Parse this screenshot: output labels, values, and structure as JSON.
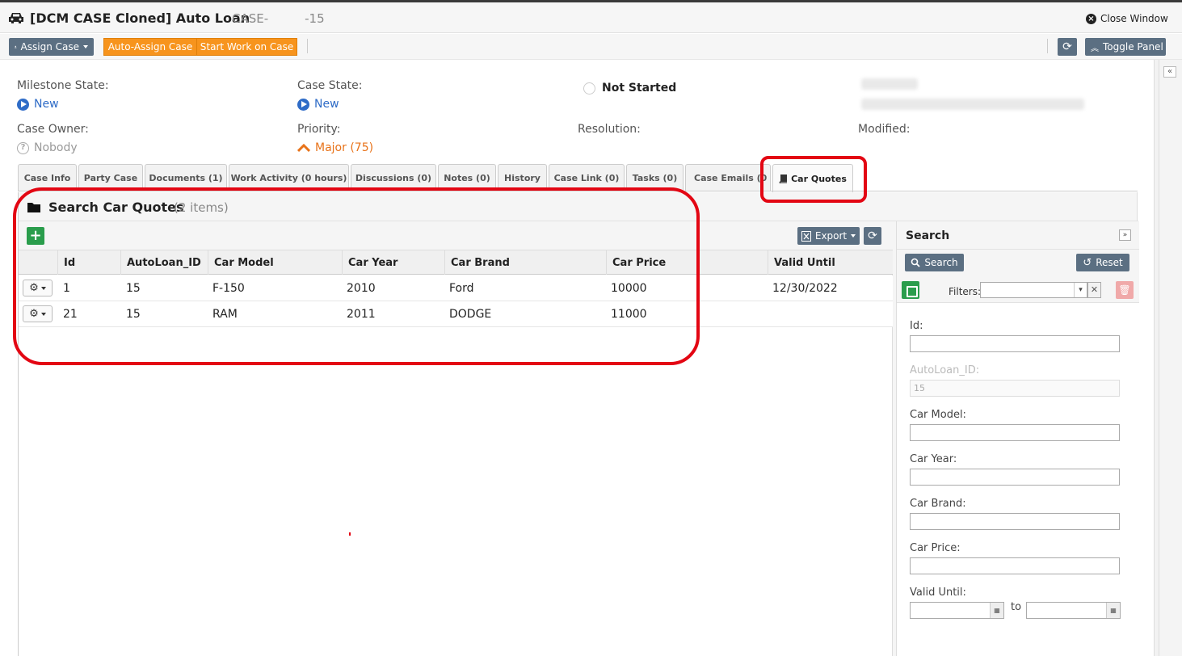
{
  "window": {
    "title": "[DCM CASE Cloned] Auto Loan",
    "case_number": "CASE-   -15",
    "close_label": "Close Window"
  },
  "toolbar": {
    "assign_case": "Assign Case",
    "auto_assign": "Auto-Assign Case",
    "start_work": "Start Work on Case",
    "toggle_panel": "Toggle Panel"
  },
  "summary": {
    "milestone_label": "Milestone State:",
    "milestone_value": "New",
    "case_state_label": "Case State:",
    "case_state_value": "New",
    "status": "Not Started",
    "owner_label": "Case Owner:",
    "owner_value": "Nobody",
    "priority_label": "Priority:",
    "priority_value": "Major (75)",
    "resolution_label": "Resolution:",
    "modified_label": "Modified:"
  },
  "tabs": [
    {
      "label": "Case Info"
    },
    {
      "label": "Party Case"
    },
    {
      "label": "Documents (1)"
    },
    {
      "label": "Work Activity (0 hours)"
    },
    {
      "label": "Discussions (0)"
    },
    {
      "label": "Notes (0)"
    },
    {
      "label": "History"
    },
    {
      "label": "Case Link (0)"
    },
    {
      "label": "Tasks (0)"
    },
    {
      "label": "Case Emails (0"
    },
    {
      "label": "Car Quotes",
      "active": true
    }
  ],
  "panel": {
    "title": "Search Car Quotes",
    "count": "(2 items)",
    "export_label": "Export"
  },
  "grid": {
    "columns": [
      "Id",
      "AutoLoan_ID",
      "Car Model",
      "Car Year",
      "Car Brand",
      "Car Price",
      "Valid Until"
    ],
    "rows": [
      [
        "1",
        "15",
        "F-150",
        "2010",
        "Ford",
        "10000",
        "12/30/2022"
      ],
      [
        "21",
        "15",
        "RAM",
        "2011",
        "DODGE",
        "11000",
        ""
      ]
    ]
  },
  "search_pane": {
    "title": "Search",
    "search_button": "Search",
    "reset_button": "Reset",
    "filters_label": "Filters:",
    "fields": {
      "id_label": "Id:",
      "autoloan_label": "AutoLoan_ID:",
      "autoloan_value": "15",
      "car_model_label": "Car Model:",
      "car_year_label": "Car Year:",
      "car_brand_label": "Car Brand:",
      "car_price_label": "Car Price:",
      "valid_until_label": "Valid Until:",
      "to_label": "to"
    }
  },
  "colors": {
    "accent_orange": "#f7941d",
    "button_gray": "#5b6f82",
    "link_blue": "#2f6cc7",
    "priority_orange": "#e8731a",
    "add_green": "#2a9d4c",
    "highlight_red": "#e30613"
  },
  "icons": [
    "car-icon",
    "close-circle-icon",
    "user-icon",
    "refresh-icon",
    "toggle-up-icon",
    "play-circle-icon",
    "question-circle-icon",
    "chevron-up-icon",
    "book-icon",
    "folder-icon",
    "plus-icon",
    "excel-icon",
    "gear-icon",
    "search-icon",
    "reset-icon",
    "save-icon",
    "trash-icon",
    "calendar-icon",
    "expand-icon",
    "collapse-icon"
  ]
}
